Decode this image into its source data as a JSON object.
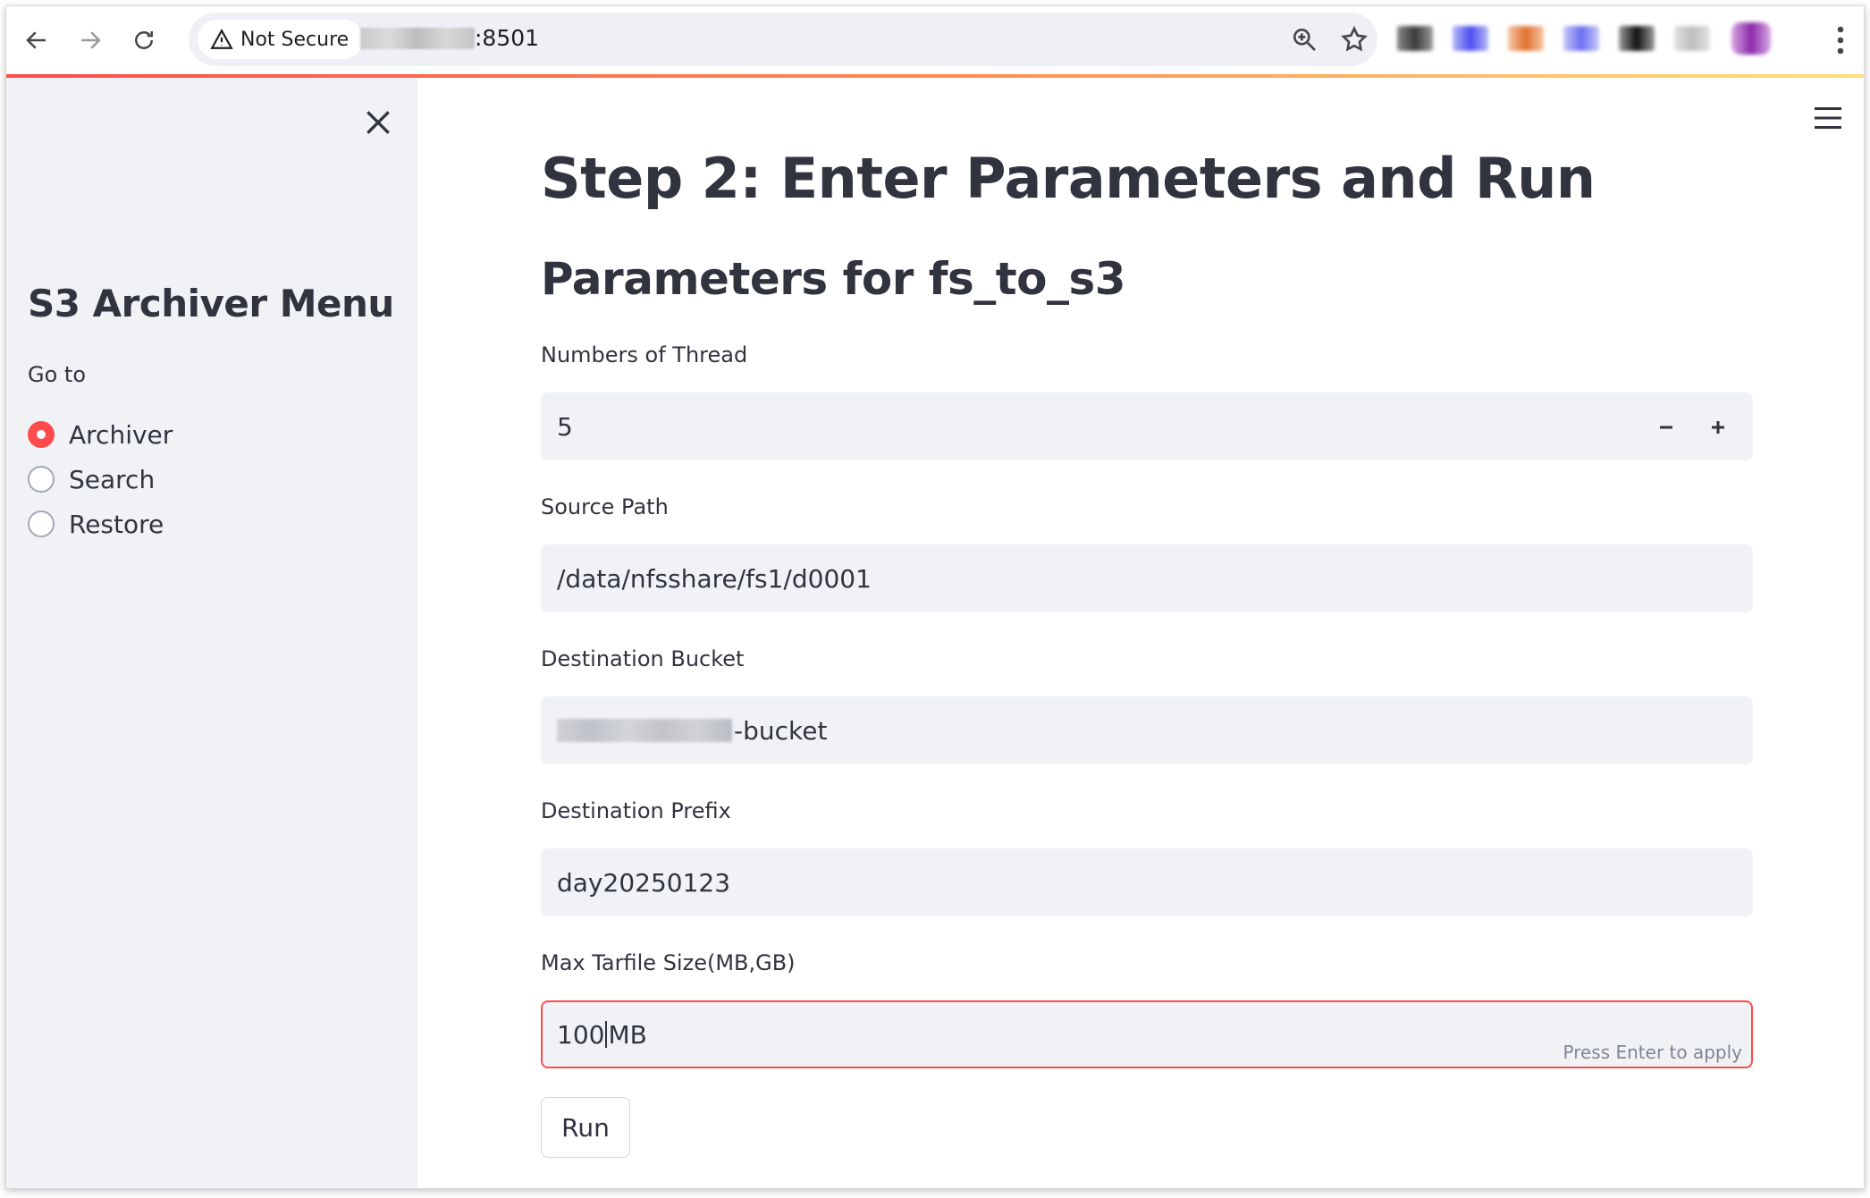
{
  "browser": {
    "security_label": "Not Secure",
    "url_suffix": ":8501"
  },
  "sidebar": {
    "title": "S3 Archiver Menu",
    "goto_label": "Go to",
    "options": [
      {
        "label": "Archiver",
        "selected": true
      },
      {
        "label": "Search",
        "selected": false
      },
      {
        "label": "Restore",
        "selected": false
      }
    ]
  },
  "main": {
    "title": "Step 2: Enter Parameters and Run",
    "subtitle": "Parameters for fs_to_s3",
    "fields": {
      "threads": {
        "label": "Numbers of Thread",
        "value": "5"
      },
      "source_path": {
        "label": "Source Path",
        "value": "/data/nfsshare/fs1/d0001"
      },
      "destination_bucket": {
        "label": "Destination Bucket",
        "value": "-bucket"
      },
      "destination_prefix": {
        "label": "Destination Prefix",
        "value": "day20250123"
      },
      "max_tarfile_size": {
        "label": "Max Tarfile Size(MB,GB)",
        "value_before_caret": "100",
        "value_after_caret": "MB",
        "hint": "Press Enter to apply"
      }
    },
    "run_label": "Run"
  },
  "colors": {
    "accent": "#ff4b4b",
    "sidebar_bg": "#f0f2f6",
    "input_bg": "#f0f2f6",
    "text": "#31333f"
  }
}
